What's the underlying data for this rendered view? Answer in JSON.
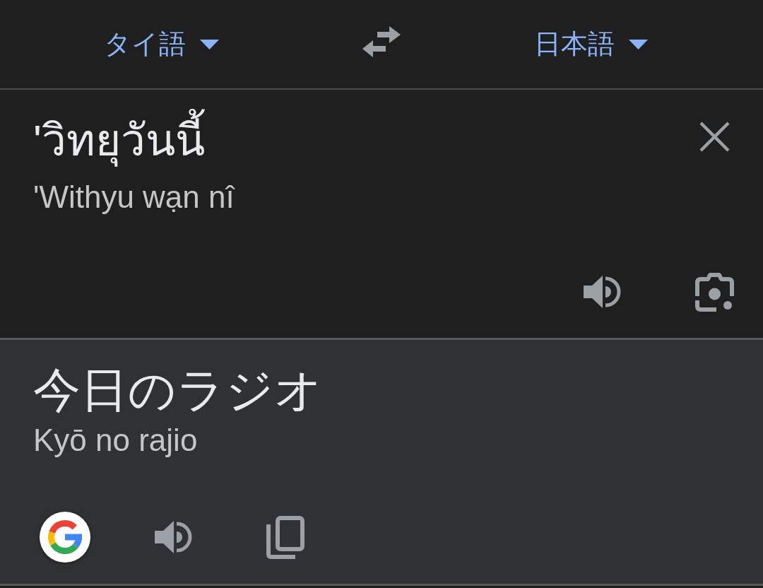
{
  "language_bar": {
    "source_language": "タイ語",
    "target_language": "日本語"
  },
  "input": {
    "text": "'วิทยุวันนี้",
    "romanization": "'Withyu wạn nî"
  },
  "output": {
    "text": "今日のラジオ",
    "romanization": "Kyō no rajio"
  }
}
